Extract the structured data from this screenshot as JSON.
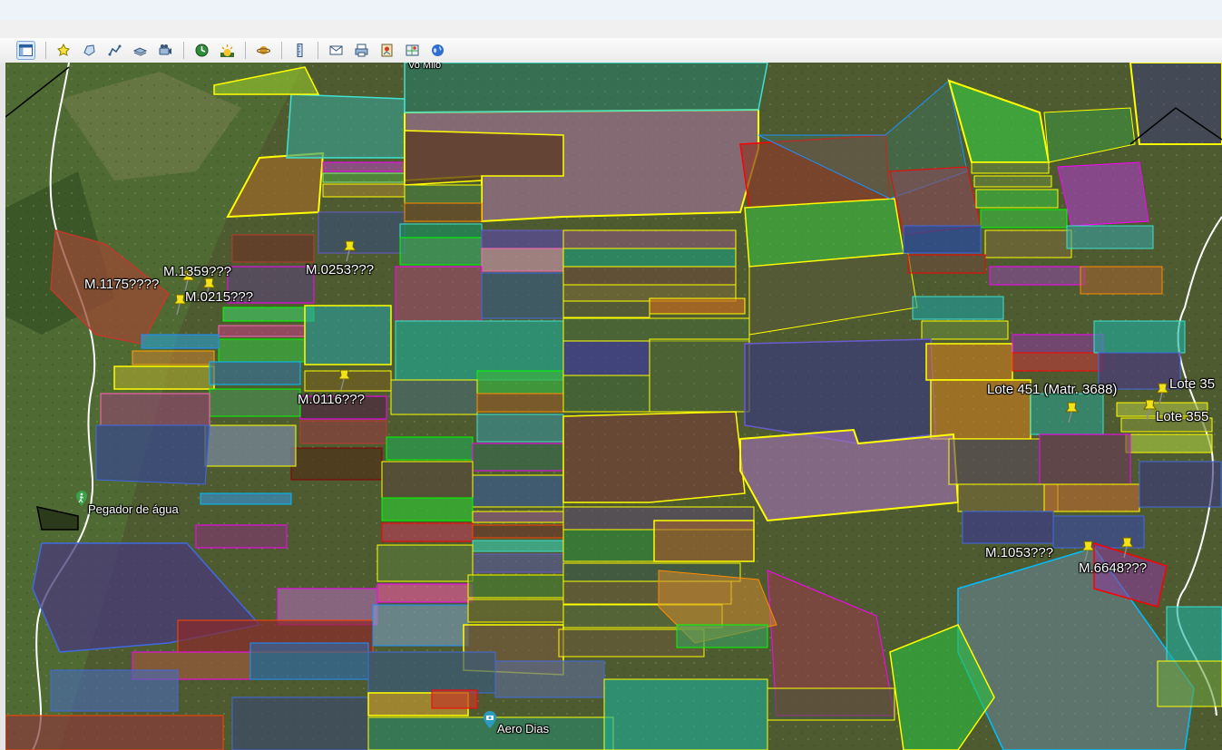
{
  "toolbar": {
    "buttons": [
      {
        "name": "sidebar-toggle-button",
        "icon": "sidebar-icon"
      },
      {
        "name": "add-placemark-button",
        "icon": "placemark-pin-icon"
      },
      {
        "name": "add-polygon-button",
        "icon": "polygon-icon"
      },
      {
        "name": "add-path-button",
        "icon": "path-icon"
      },
      {
        "name": "image-overlay-button",
        "icon": "image-overlay-icon"
      },
      {
        "name": "record-tour-button",
        "icon": "tour-camera-icon"
      },
      {
        "name": "historical-imagery-button",
        "icon": "clock-globe-icon"
      },
      {
        "name": "sunlight-button",
        "icon": "sunlight-icon"
      },
      {
        "name": "planets-button",
        "icon": "planet-icon"
      },
      {
        "name": "ruler-button",
        "icon": "ruler-icon"
      },
      {
        "name": "email-button",
        "icon": "email-icon"
      },
      {
        "name": "print-button",
        "icon": "print-icon"
      },
      {
        "name": "save-image-button",
        "icon": "save-image-icon"
      },
      {
        "name": "view-in-maps-button",
        "icon": "maps-icon"
      },
      {
        "name": "earth-button",
        "icon": "earth-globe-icon"
      }
    ]
  },
  "map": {
    "partial_top_label": "Vo Milo",
    "placemarks": [
      {
        "id": "m1359",
        "label": "M.1359???"
      },
      {
        "id": "m1175",
        "label": "M.1175????"
      },
      {
        "id": "m0215",
        "label": "M.0215???"
      },
      {
        "id": "m0253",
        "label": "M.0253???"
      },
      {
        "id": "m0116",
        "label": "M.0116???"
      },
      {
        "id": "lote451",
        "label": "Lote 451 (Matr. 3688)"
      },
      {
        "id": "lote35a",
        "label": "Lote 35"
      },
      {
        "id": "lote355",
        "label": "Lote 355"
      },
      {
        "id": "m1053",
        "label": "M.1053???"
      },
      {
        "id": "m6648",
        "label": "M.6648???"
      }
    ],
    "pois": [
      {
        "id": "pegador",
        "label": "Pegador de água",
        "icon": "hiking-person-icon"
      },
      {
        "id": "aero",
        "label": "Aero Dias",
        "icon": "camera-poi-icon"
      }
    ],
    "colors": {
      "satellite_base": "#4e5a30",
      "polygon_outline_primary": "#ffff00",
      "pin": "#f2e21a"
    }
  }
}
